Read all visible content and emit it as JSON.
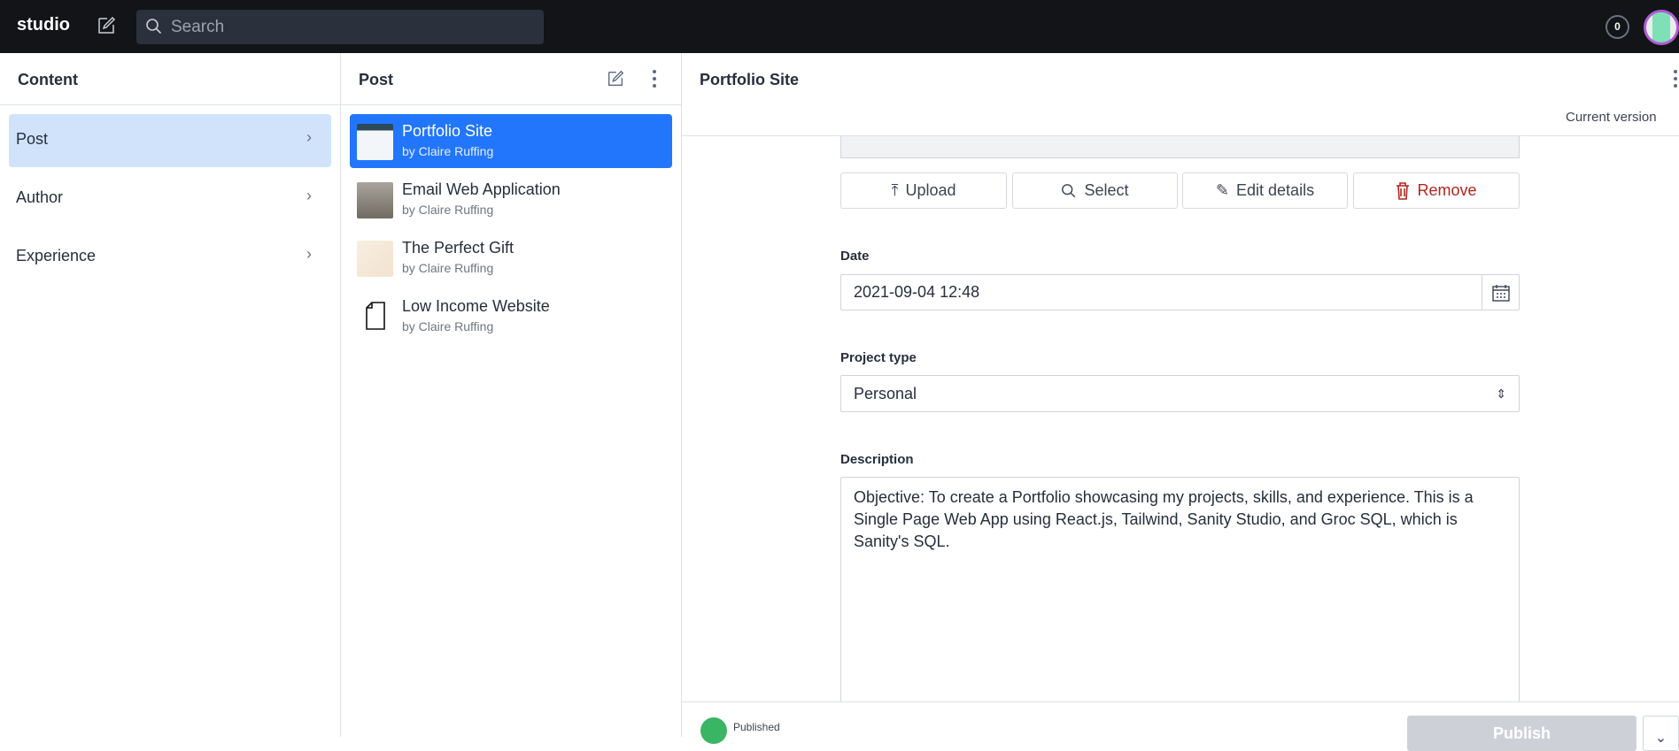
{
  "topbar": {
    "logo": "studio",
    "search_placeholder": "Search",
    "notification_count": "0"
  },
  "content_pane": {
    "title": "Content",
    "items": [
      {
        "label": "Post"
      },
      {
        "label": "Author"
      },
      {
        "label": "Experience"
      }
    ]
  },
  "post_pane": {
    "title": "Post",
    "documents": [
      {
        "title": "Portfolio Site",
        "subtitle": "by Claire Ruffing"
      },
      {
        "title": "Email Web Application",
        "subtitle": "by Claire Ruffing"
      },
      {
        "title": "The Perfect Gift",
        "subtitle": "by Claire Ruffing"
      },
      {
        "title": "Low Income Website",
        "subtitle": "by Claire Ruffing"
      }
    ]
  },
  "editor": {
    "title": "Portfolio Site",
    "version": "Current version",
    "image_buttons": {
      "upload": "Upload",
      "select": "Select",
      "edit": "Edit details",
      "remove": "Remove"
    },
    "date": {
      "label": "Date",
      "value": "2021-09-04 12:48"
    },
    "project_type": {
      "label": "Project type",
      "value": "Personal"
    },
    "description": {
      "label": "Description",
      "value": "Objective: To create a Portfolio showcasing my projects, skills, and experience. This is a Single Page Web App using React.js, Tailwind, Sanity Studio, and Groc SQL, which is Sanity's SQL."
    },
    "footer": {
      "status": "Published",
      "publish": "Publish"
    }
  },
  "colors": {
    "accent": "#2276fc",
    "selected_nav": "#d1e3fb",
    "remove": "#b3261e",
    "published": "#3ab564"
  }
}
